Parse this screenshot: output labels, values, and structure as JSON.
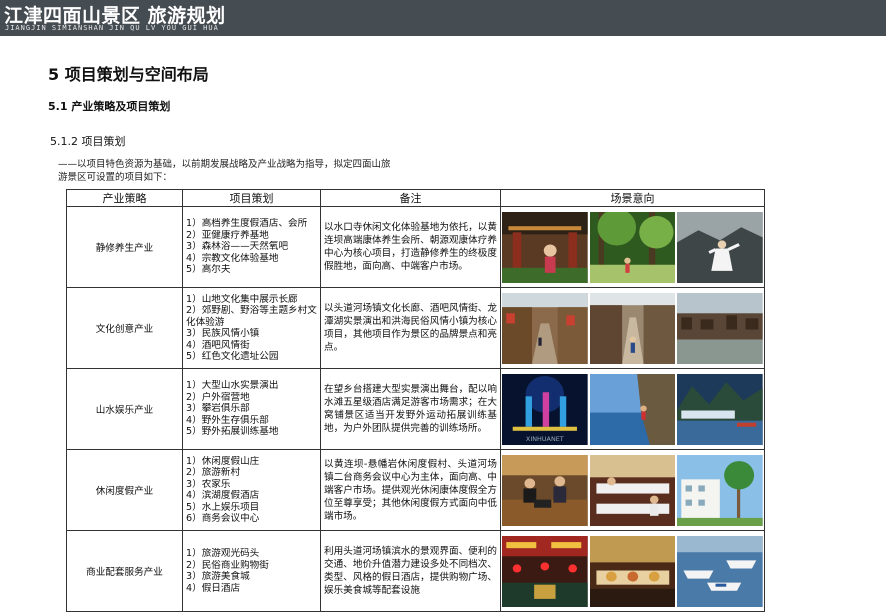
{
  "header": {
    "title": "江津四面山景区 旅游规划",
    "subtitle": "JIANGJIN SIMIANSHAN JIN QU   LV YOU GUI HUA"
  },
  "section": {
    "heading": "5  项目策划与空间布局",
    "sub_heading": "5.1  产业策略及项目策划",
    "sub_sub_heading": "5.1.2   项目策划",
    "intro": "——以项目特色资源为基础，以前期发展战略及产业战略为指导，拟定四面山旅游景区可设置的项目如下："
  },
  "table": {
    "headers": [
      "产业策略",
      "项目策划",
      "备注",
      "场景意向"
    ],
    "rows": [
      {
        "industry": "静修养生产业",
        "projects": [
          "1）高档养生度假酒店、会所",
          "2）亚健康疗养基地",
          "3）森林浴——天然氧吧",
          "4）宗教文化体验基地",
          "5）高尔夫"
        ],
        "note": "以水口寺休闲文化体验基地为依托，以黄连坝高端康体养生会所、朝源观康体疗养中心为核心项目，打造静修养生的终极度假胜地，面向高、中端客户市场。",
        "images": [
          "temple-scene-image",
          "forest-bath-image",
          "taichi-scene-image"
        ]
      },
      {
        "industry": "文化创意产业",
        "projects": [
          "1）山地文化集中展示长廊",
          "2）郊野剧、野浴等主题乡村文化体验游",
          "3）民族风情小镇",
          "4）酒吧风情街",
          "5）红色文化遗址公园"
        ],
        "note": "以头道河场镇文化长廊、酒吧风情街、龙潭湖实景演出和洪海民俗风情小镇为核心项目，其他项目作为景区的品牌景点和亮点。",
        "images": [
          "old-town-street-image",
          "village-alley-image",
          "riverside-town-image"
        ]
      },
      {
        "industry": "山水娱乐产业",
        "projects": [
          "1）大型山水实景演出",
          "2）户外宿营地",
          "3）攀岩俱乐部",
          "4）野外生存俱乐部",
          "5）野外拓展训练基地"
        ],
        "note": "在望乡台搭建大型实景演出舞台，配以响水滩五星级酒店满足游客市场需求；在大窝铺景区适当开发野外运动拓展训练基地，为户外团队提供完善的训练场所。",
        "images": [
          "night-performance-image",
          "rock-climbing-image",
          "lakeside-mountain-image"
        ]
      },
      {
        "industry": "休闲度假产业",
        "projects": [
          "1）休闲度假山庄",
          "2）旅游新村",
          "3）农家乐",
          "4）滨湖度假酒店",
          "5）水上娱乐项目",
          "6）商务会议中心"
        ],
        "note": "以黄连坝-悬幡岩休闲度假村、头道河场镇二台商务会议中心为主体，面向高、中端客户市场。提供观光休闲康体度假全方位至尊享受；其他休闲度假方式面向中低端市场。",
        "images": [
          "business-meeting-image",
          "dining-hall-image",
          "resort-palm-image"
        ]
      },
      {
        "industry": "商业配套服务产业",
        "projects": [
          "1）旅游观光码头",
          "2）民俗商业购物街",
          "3）旅游美食城",
          "4）假日酒店"
        ],
        "note": "利用头道河场镇滨水的景观界面、便利的交通、地价升值潜力建设多处不同档次、类型、风格的假日酒店，提供购物广场、娱乐美食城等配套设施",
        "images": [
          "shopping-street-image",
          "food-stall-image",
          "speedboat-dock-image"
        ]
      }
    ]
  },
  "watermark": "XINHUANET"
}
